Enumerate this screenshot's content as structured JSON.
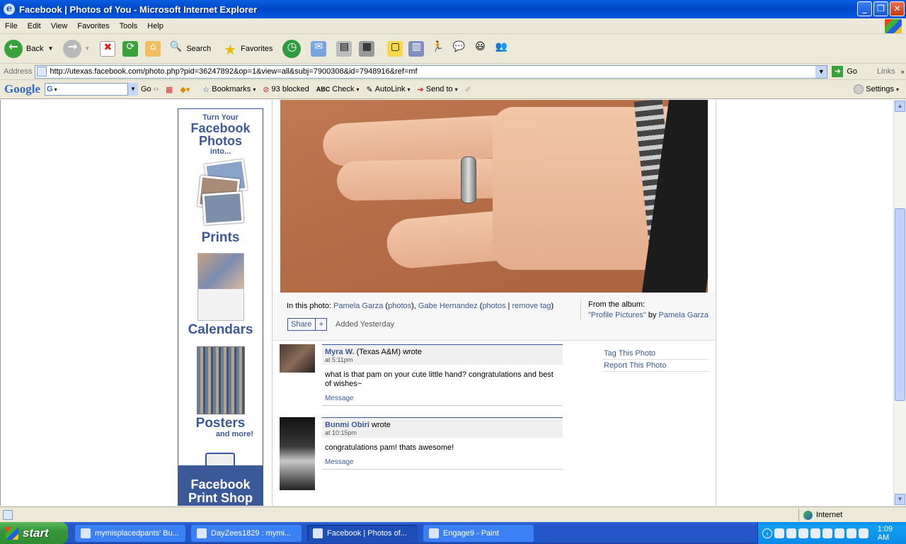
{
  "window": {
    "title": "Facebook | Photos of You - Microsoft Internet Explorer"
  },
  "menu": [
    "File",
    "Edit",
    "View",
    "Favorites",
    "Tools",
    "Help"
  ],
  "toolbar": {
    "back": "Back",
    "search": "Search",
    "favorites": "Favorites"
  },
  "address": {
    "label": "Address",
    "url": "http://utexas.facebook.com/photo.php?pid=36247892&op=1&view=all&subj=7900308&id=7948916&ref=mf",
    "go": "Go",
    "links": "Links"
  },
  "google_toolbar": {
    "logo": "Google",
    "go": "Go",
    "bookmarks": "Bookmarks",
    "blocked": "93 blocked",
    "check": "Check",
    "autolink": "AutoLink",
    "sendto": "Send to",
    "settings": "Settings"
  },
  "ad": {
    "line1": "Turn Your",
    "line2": "Facebook",
    "line3": "Photos",
    "line4": "into...",
    "prints": "Prints",
    "calendars": "Calendars",
    "posters": "Posters",
    "more": "and more!",
    "shop1": "Facebook",
    "shop2": "Print Shop"
  },
  "caption": {
    "in_photo": "In this photo:",
    "person1": "Pamela Garza",
    "photos": "photos",
    "person2": "Gabe Hernandez",
    "remove": "remove tag",
    "share": "Share",
    "added": "Added Yesterday",
    "from_album": "From the album:",
    "album": "\"Profile Pictures\"",
    "by": "by",
    "owner": "Pamela Garza"
  },
  "comments": [
    {
      "name": "Myra W.",
      "network": "(Texas A&M)",
      "wrote": "wrote",
      "time": "at 5:11pm",
      "text": "what is that pam on your cute little hand? congratulations and best of wishes~",
      "message": "Message"
    },
    {
      "name": "Bunmi Obiri",
      "network": "",
      "wrote": "wrote",
      "time": "at 10:15pm",
      "text": "congratulations pam! thats awesome!",
      "message": "Message"
    }
  ],
  "actions": {
    "tag": "Tag This Photo",
    "report": "Report This Photo"
  },
  "status": {
    "zone": "Internet"
  },
  "taskbar": {
    "start": "start",
    "tasks": [
      "mymisplacedpants' Bu...",
      "DayZees1829 : mymi...",
      "Facebook | Photos of...",
      "Engage9 - Paint"
    ],
    "clock": "1:09 AM"
  }
}
